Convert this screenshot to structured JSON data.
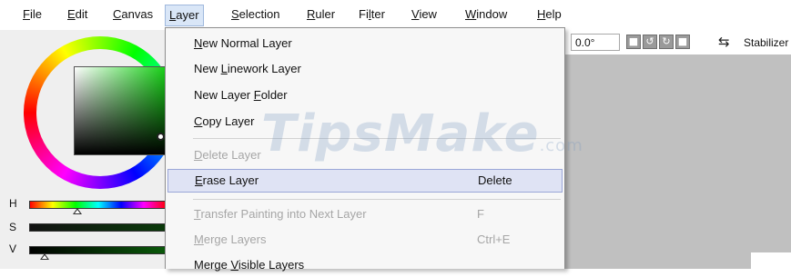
{
  "menubar": {
    "items": [
      {
        "pre": "",
        "acc": "F",
        "post": "ile"
      },
      {
        "pre": "",
        "acc": "E",
        "post": "dit"
      },
      {
        "pre": "",
        "acc": "C",
        "post": "anvas"
      },
      {
        "pre": "",
        "acc": "L",
        "post": "ayer"
      },
      {
        "pre": "",
        "acc": "S",
        "post": "election"
      },
      {
        "pre": "",
        "acc": "R",
        "post": "uler"
      },
      {
        "pre": "Fi",
        "acc": "l",
        "post": "ter"
      },
      {
        "pre": "",
        "acc": "V",
        "post": "iew"
      },
      {
        "pre": "",
        "acc": "W",
        "post": "indow"
      },
      {
        "pre": "",
        "acc": "H",
        "post": "elp"
      }
    ]
  },
  "color_panel": {
    "labels": {
      "h": "H",
      "s": "S",
      "v": "V"
    },
    "hue_color": "#00cc00"
  },
  "toolbar": {
    "angle_value": "0.0°",
    "btn_icons": [
      "square",
      "rotate-left",
      "rotate-right",
      "square"
    ],
    "swap_glyph": "⇆",
    "stabilizer_label": "Stabilizer"
  },
  "layer_menu": {
    "items": [
      {
        "pre": "",
        "acc": "N",
        "post": "ew Normal Layer",
        "shortcut": ""
      },
      {
        "pre": "New ",
        "acc": "L",
        "post": "inework Layer",
        "shortcut": ""
      },
      {
        "pre": "New Layer ",
        "acc": "F",
        "post": "older",
        "shortcut": ""
      },
      {
        "pre": "",
        "acc": "C",
        "post": "opy Layer",
        "shortcut": ""
      },
      {
        "pre": "",
        "acc": "D",
        "post": "elete Layer",
        "shortcut": ""
      },
      {
        "pre": "",
        "acc": "E",
        "post": "rase Layer",
        "shortcut": "Delete"
      },
      {
        "pre": "",
        "acc": "T",
        "post": "ransfer Painting into Next Layer",
        "shortcut": "F"
      },
      {
        "pre": "",
        "acc": "M",
        "post": "erge Layers",
        "shortcut": "Ctrl+E"
      },
      {
        "pre": "Merge ",
        "acc": "V",
        "post": "isible Layers",
        "shortcut": ""
      }
    ]
  },
  "watermark": {
    "main": "TipsMake",
    "suffix": ".com"
  }
}
